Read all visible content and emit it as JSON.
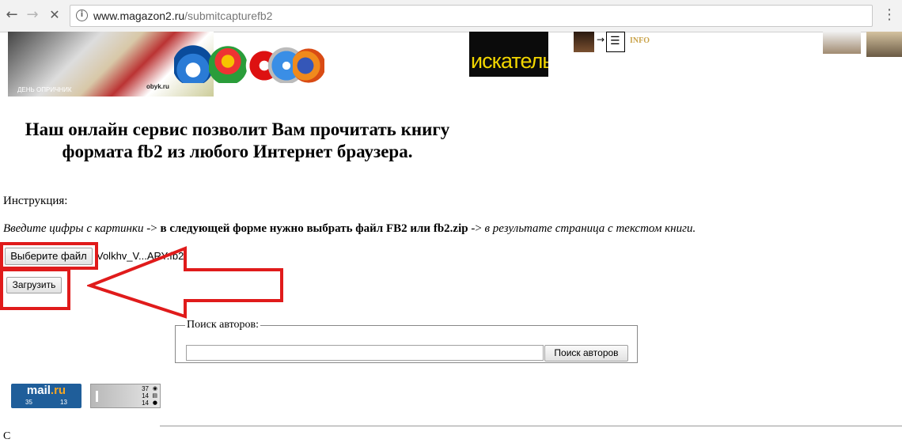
{
  "browser": {
    "url_domain": "www.magazon2.ru",
    "url_path": "/submitcapturefb2",
    "back_icon": "←",
    "forward_icon": "→",
    "stop_icon": "✕",
    "info_icon": "i",
    "menu_icon": "⋮"
  },
  "banner": {
    "collage_caption_left": "ДЕНЬ ОПРИЧНИК",
    "collage_caption_right": "obyk.ru",
    "searcher_text": "искатель",
    "info_label": "INFO",
    "arrow_glyph": "→",
    "doc_glyph": "☰"
  },
  "headline": "Наш онлайн сервис позволит Вам прочитать книгу формата fb2 из любого Интернет браузера.",
  "instruction": {
    "label": "Инструкция:",
    "step1": "Введите цифры с картинки",
    "sep1": " -> ",
    "step2": "в следующей форме нужно выбрать файл FB2 или fb2.zip",
    "sep2": " -> ",
    "step3": "в результате страница с текстом книги."
  },
  "upload_form": {
    "file_button": "Выберите файл",
    "file_name": "Volkhv_V...ARY.fb2",
    "submit_button": "Загрузить"
  },
  "author_search": {
    "legend": "Поиск авторов:",
    "input_value": "",
    "button": "Поиск авторов"
  },
  "counters": {
    "mailru_logo_main": "mail",
    "mailru_logo_dot": ".ru",
    "mailru_left": "35",
    "mailru_right": "13",
    "liveinternet_values": [
      "37",
      "14",
      "14"
    ]
  },
  "colors": {
    "highlight": "#e01b1b",
    "searcher_text": "#f2d600",
    "mailru_bg": "#1f5e9a"
  },
  "footer_glyph": "С"
}
